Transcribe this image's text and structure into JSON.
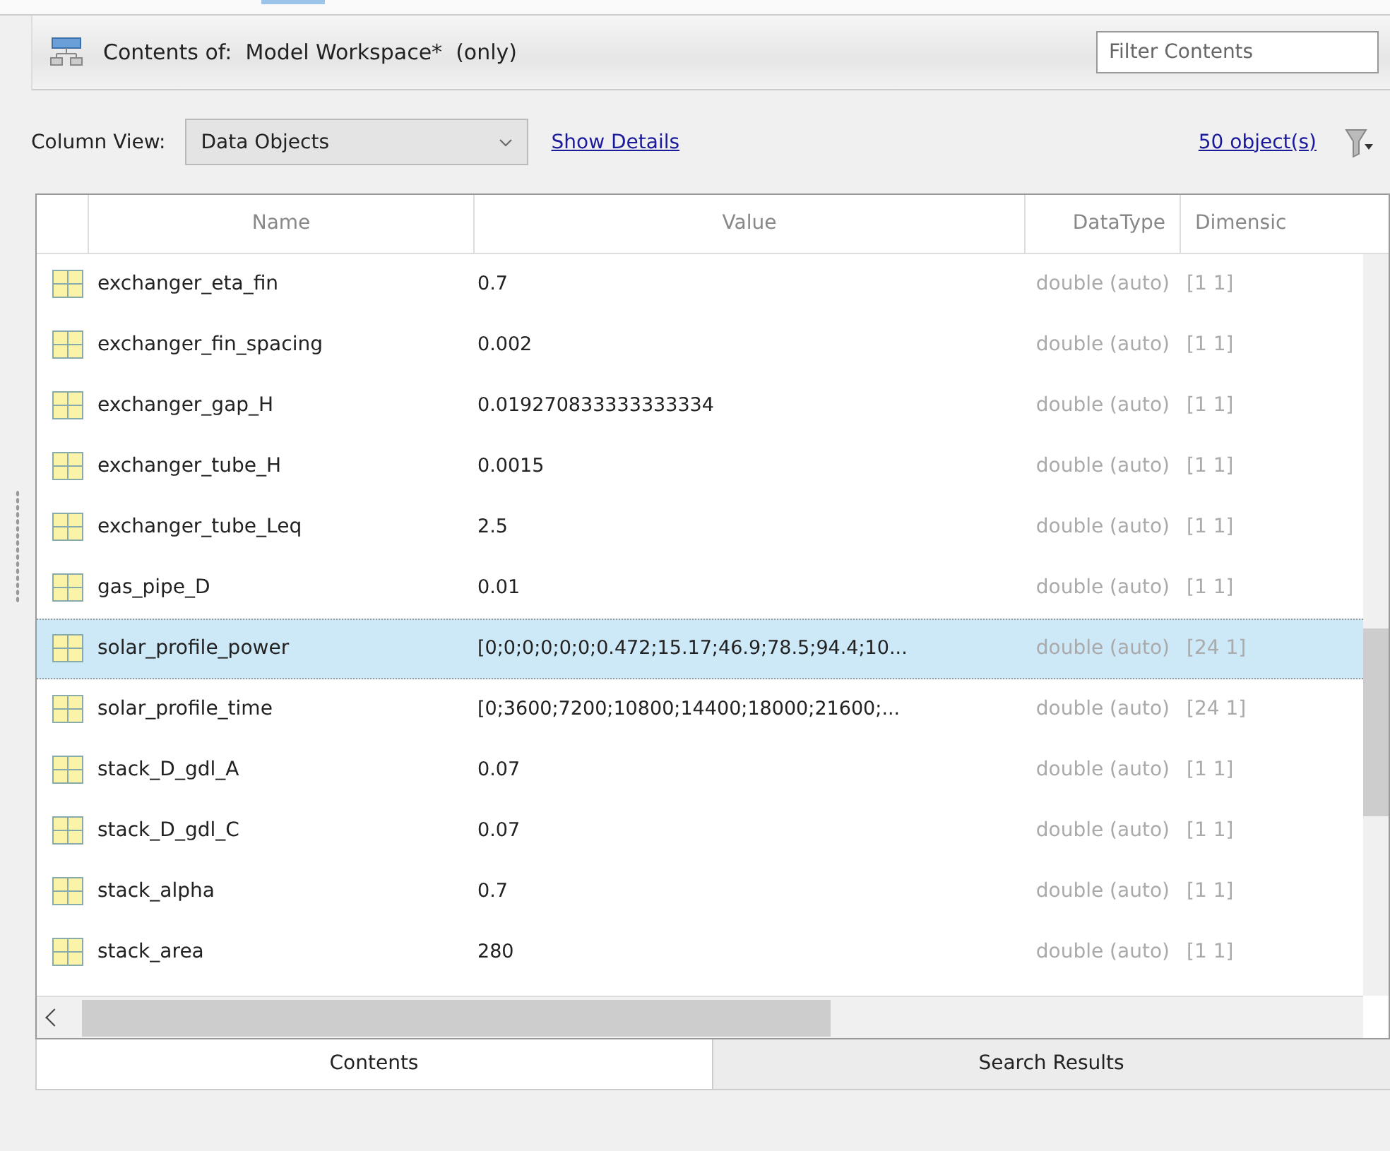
{
  "header": {
    "title": "Contents of:  Model Workspace*  (only)",
    "filter": {
      "placeholder": "Filter Contents"
    }
  },
  "toolbar": {
    "column_view_label": "Column View:",
    "column_view": "Data Objects",
    "show_details": "Show Details",
    "object_count": "50 object(s)"
  },
  "table": {
    "columns": [
      "Name",
      "Value",
      "DataType",
      "Dimensic"
    ],
    "rows": [
      {
        "name": "exchanger_eta_fin",
        "value": "0.7",
        "datatype": "double (auto)",
        "dimensions": "[1 1]",
        "selected": false
      },
      {
        "name": "exchanger_fin_spacing",
        "value": "0.002",
        "datatype": "double (auto)",
        "dimensions": "[1 1]",
        "selected": false
      },
      {
        "name": "exchanger_gap_H",
        "value": "0.019270833333333334",
        "datatype": "double (auto)",
        "dimensions": "[1 1]",
        "selected": false
      },
      {
        "name": "exchanger_tube_H",
        "value": "0.0015",
        "datatype": "double (auto)",
        "dimensions": "[1 1]",
        "selected": false
      },
      {
        "name": "exchanger_tube_Leq",
        "value": "2.5",
        "datatype": "double (auto)",
        "dimensions": "[1 1]",
        "selected": false
      },
      {
        "name": "gas_pipe_D",
        "value": "0.01",
        "datatype": "double (auto)",
        "dimensions": "[1 1]",
        "selected": false
      },
      {
        "name": "solar_profile_power",
        "value": "[0;0;0;0;0;0;0.472;15.17;46.9;78.5;94.4;10...",
        "datatype": "double (auto)",
        "dimensions": "[24 1]",
        "selected": true
      },
      {
        "name": "solar_profile_time",
        "value": "[0;3600;7200;10800;14400;18000;21600;...",
        "datatype": "double (auto)",
        "dimensions": "[24 1]",
        "selected": false
      },
      {
        "name": "stack_D_gdl_A",
        "value": "0.07",
        "datatype": "double (auto)",
        "dimensions": "[1 1]",
        "selected": false
      },
      {
        "name": "stack_D_gdl_C",
        "value": "0.07",
        "datatype": "double (auto)",
        "dimensions": "[1 1]",
        "selected": false
      },
      {
        "name": "stack_alpha",
        "value": "0.7",
        "datatype": "double (auto)",
        "dimensions": "[1 1]",
        "selected": false
      },
      {
        "name": "stack_area",
        "value": "280",
        "datatype": "double (auto)",
        "dimensions": "[1 1]",
        "selected": false
      }
    ]
  },
  "tabs": [
    {
      "label": "Contents",
      "selected": true
    },
    {
      "label": "Search Results",
      "selected": false
    }
  ]
}
